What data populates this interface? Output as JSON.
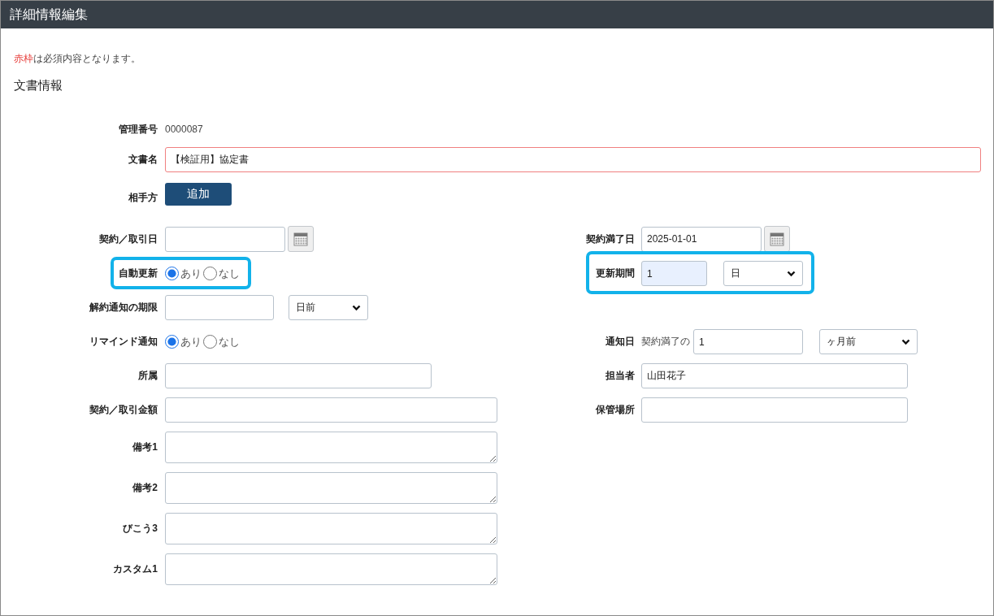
{
  "title": "詳細情報編集",
  "note": {
    "emphasis": "赤枠",
    "text": "は必須内容となります。"
  },
  "section_title": "文書情報",
  "rows": [
    {
      "left": {
        "kind": "static",
        "label": "管理番号",
        "value": "0000087"
      }
    },
    {
      "left": {
        "kind": "wide_input",
        "label": "文書名",
        "value": "【検証用】協定書",
        "required": true
      }
    },
    {
      "left": {
        "kind": "button",
        "label": "相手方",
        "button": "追加"
      }
    },
    {
      "left": {
        "kind": "date",
        "label": "契約／取引日"
      },
      "right": {
        "kind": "date",
        "label": "契約満了日",
        "value": "2025-01-01"
      }
    },
    {
      "left": {
        "kind": "radio",
        "label": "自動更新",
        "highlighted": true,
        "options": [
          {
            "label": "あり",
            "selected": true
          },
          {
            "label": "なし",
            "selected": false
          }
        ]
      },
      "right": {
        "kind": "input_select",
        "label": "更新期間",
        "value": "1",
        "autofilled": true,
        "highlighted": true,
        "select": "日"
      }
    },
    {
      "left": {
        "kind": "input_select",
        "label": "解約通知の期限",
        "select": "日前"
      }
    },
    {
      "left": {
        "kind": "radio",
        "label": "リマインド通知",
        "options": [
          {
            "label": "あり",
            "selected": true
          },
          {
            "label": "なし",
            "selected": false
          }
        ]
      },
      "right": {
        "kind": "prefix_input_select",
        "label": "通知日",
        "prefix": "契約満了の",
        "value": "1",
        "select": "ヶ月前"
      }
    },
    {
      "left": {
        "kind": "short_input",
        "label": "所属"
      },
      "right": {
        "kind": "short_input",
        "label": "担当者",
        "value": "山田花子"
      }
    },
    {
      "left": {
        "kind": "input",
        "label": "契約／取引金額"
      },
      "right": {
        "kind": "short_input",
        "label": "保管場所"
      }
    },
    {
      "left": {
        "kind": "textarea",
        "label": "備考1"
      }
    },
    {
      "left": {
        "kind": "textarea",
        "label": "備考2"
      }
    },
    {
      "left": {
        "kind": "textarea",
        "label": "びこう3"
      }
    },
    {
      "left": {
        "kind": "textarea",
        "label": "カスタム1"
      }
    }
  ]
}
